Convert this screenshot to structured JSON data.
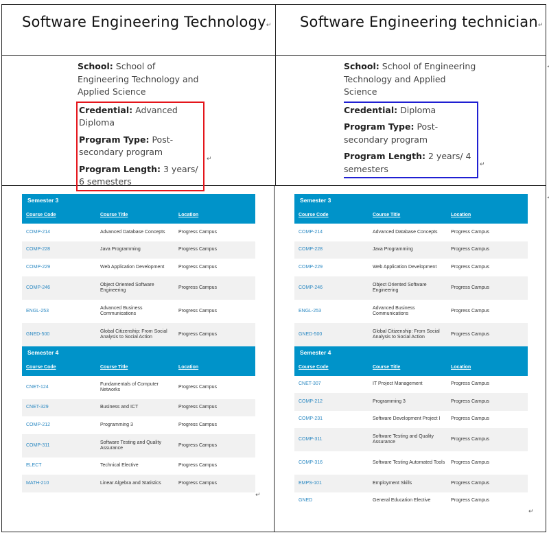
{
  "headings": {
    "left": "Software Engineering Technology",
    "right": "Software Engineering technician"
  },
  "left_info": {
    "school_label": "School:",
    "school_value": "School of Engineering Technology and Applied Science",
    "credential_label": "Credential:",
    "credential_value": "Advanced Diploma",
    "program_type_label": "Program Type:",
    "program_type_value": "Post-secondary program",
    "program_length_label": "Program Length:",
    "program_length_value": "3 years/ 6 semesters"
  },
  "right_info": {
    "school_label": "School:",
    "school_value": "School of Engineering Technology and Applied Science",
    "credential_label": "Credential:",
    "credential_value": "Diploma",
    "program_type_label": "Program Type:",
    "program_type_value": "Post-secondary program",
    "program_length_label": "Program Length:",
    "program_length_value": "2 years/ 4 semesters"
  },
  "table_headers": {
    "code": "Course Code",
    "title": "Course Title",
    "location": "Location"
  },
  "left_tables": {
    "semester3": {
      "title": "Semester 3",
      "rows": [
        {
          "code": "COMP-214",
          "title": "Advanced Database Concepts",
          "location": "Progress Campus"
        },
        {
          "code": "COMP-228",
          "title": "Java Programming",
          "location": "Progress Campus"
        },
        {
          "code": "COMP-229",
          "title": "Web Application Development",
          "location": "Progress Campus"
        },
        {
          "code": "COMP-246",
          "title": "Object Oriented Software Engineering",
          "location": "Progress Campus"
        },
        {
          "code": "ENGL-253",
          "title": "Advanced Business Communications",
          "location": "Progress Campus"
        },
        {
          "code": "GNED-500",
          "title": "Global Citizenship: From Social Analysis to Social Action",
          "location": "Progress Campus"
        }
      ]
    },
    "semester4": {
      "title": "Semester 4",
      "rows": [
        {
          "code": "CNET-124",
          "title": "Fundamentals of Computer Networks",
          "location": "Progress Campus"
        },
        {
          "code": "CNET-329",
          "title": "Business and ICT",
          "location": "Progress Campus"
        },
        {
          "code": "COMP-212",
          "title": "Programming 3",
          "location": "Progress Campus"
        },
        {
          "code": "COMP-311",
          "title": "Software Testing and Quality Assurance",
          "location": "Progress Campus"
        },
        {
          "code": "ELECT",
          "title": "Technical Elective",
          "location": "Progress Campus"
        },
        {
          "code": "MATH-210",
          "title": "Linear Algebra and Statistics",
          "location": "Progress Campus"
        }
      ]
    }
  },
  "right_tables": {
    "semester3": {
      "title": "Semester 3",
      "rows": [
        {
          "code": "COMP-214",
          "title": "Advanced Database Concepts",
          "location": "Progress Campus"
        },
        {
          "code": "COMP-228",
          "title": "Java Programming",
          "location": "Progress Campus"
        },
        {
          "code": "COMP-229",
          "title": "Web Application Development",
          "location": "Progress Campus"
        },
        {
          "code": "COMP-246",
          "title": "Object Oriented Software Engineering",
          "location": "Progress Campus"
        },
        {
          "code": "ENGL-253",
          "title": "Advanced Business Communications",
          "location": "Progress Campus"
        },
        {
          "code": "GNED-500",
          "title": "Global Citizenship: From Social Analysis to Social Action",
          "location": "Progress Campus"
        }
      ]
    },
    "semester4": {
      "title": "Semester 4",
      "rows": [
        {
          "code": "CNET-307",
          "title": "IT Project Management",
          "location": "Progress Campus"
        },
        {
          "code": "COMP-212",
          "title": "Programming 3",
          "location": "Progress Campus"
        },
        {
          "code": "COMP-231",
          "title": "Software Development Project I",
          "location": "Progress Campus"
        },
        {
          "code": "COMP-311",
          "title": "Software Testing and Quality Assurance",
          "location": "Progress Campus"
        },
        {
          "code": "COMP-316",
          "title": "Software Testing Automated Tools",
          "location": "Progress Campus"
        },
        {
          "code": "EMPS-101",
          "title": "Employment Skills",
          "location": "Progress Campus"
        },
        {
          "code": "GNED",
          "title": "General Education Elective",
          "location": "Progress Campus"
        }
      ]
    }
  }
}
